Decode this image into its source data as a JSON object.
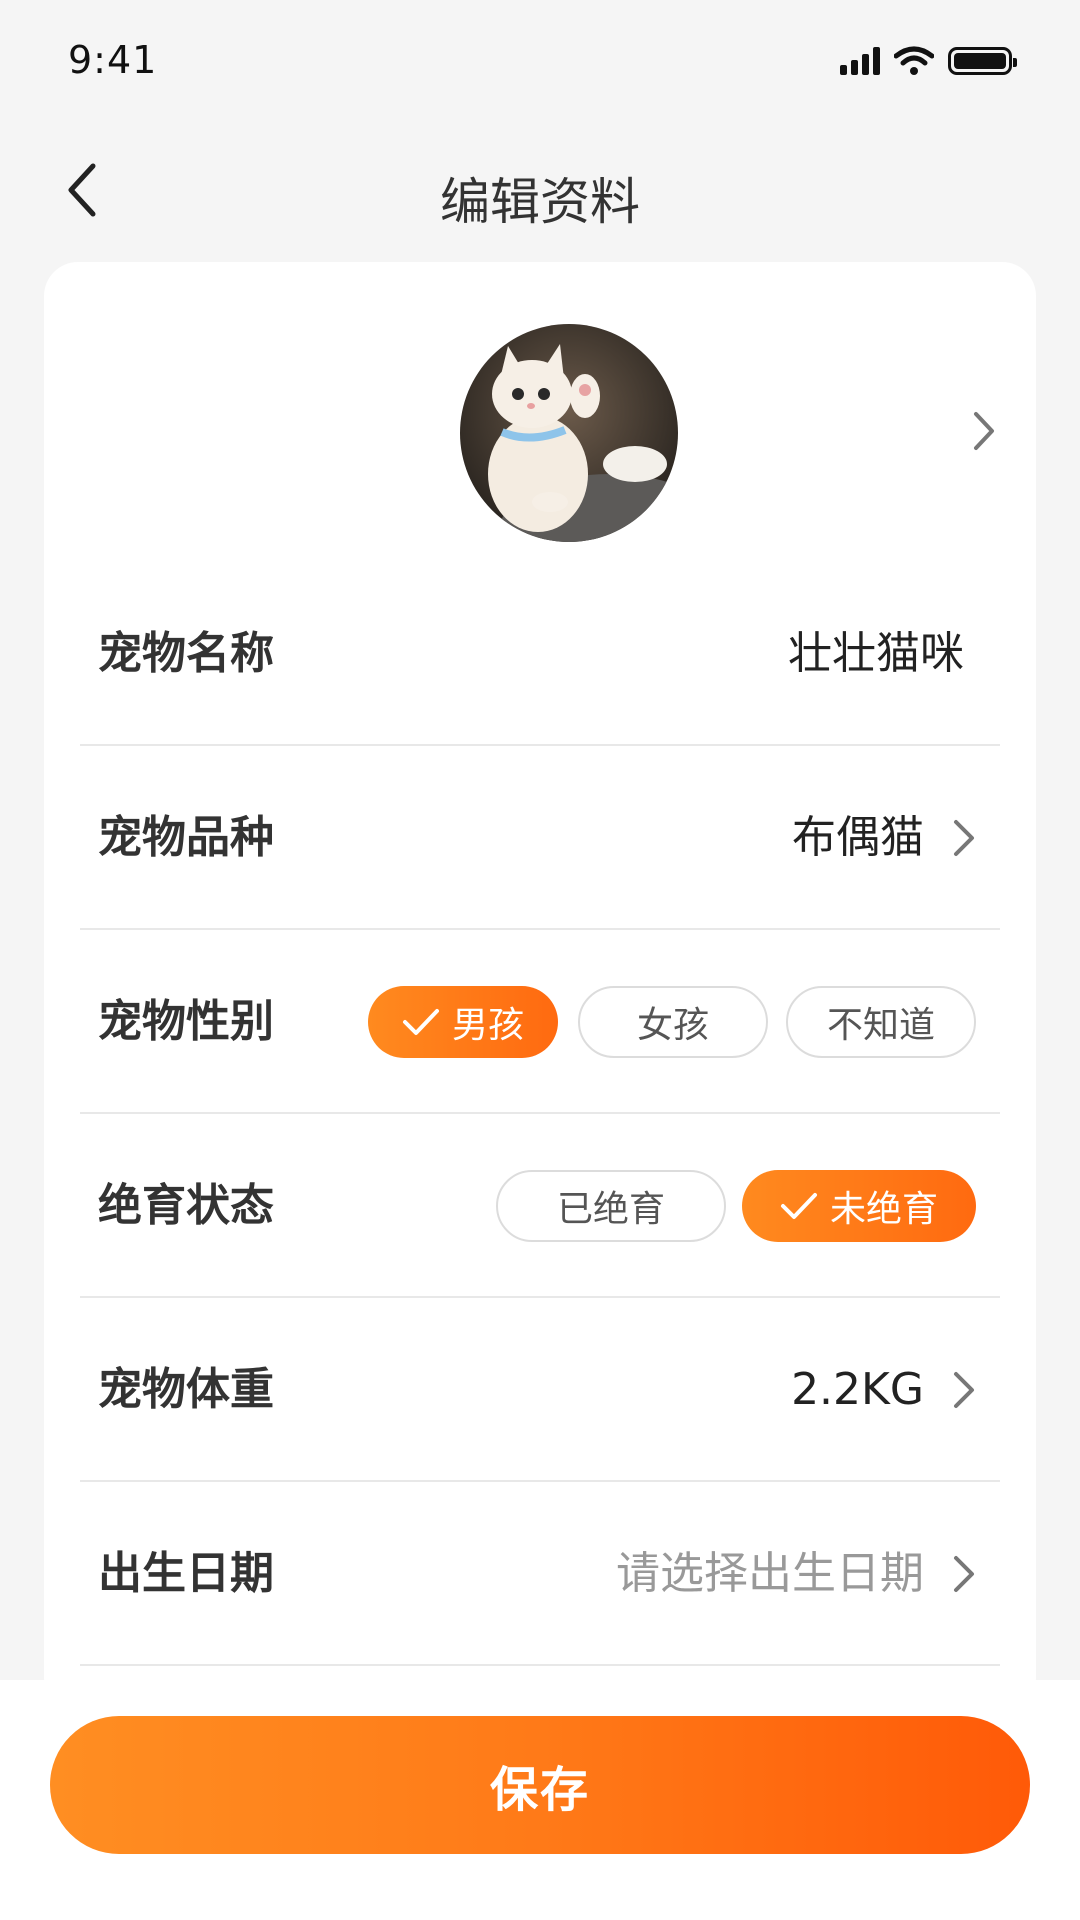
{
  "status_bar": {
    "time": "9:41"
  },
  "header": {
    "title": "编辑资料"
  },
  "profile": {
    "avatar": "cat-photo",
    "fields": {
      "name": {
        "label": "宠物名称",
        "value": "壮壮猫咪"
      },
      "breed": {
        "label": "宠物品种",
        "value": "布偶猫"
      },
      "gender": {
        "label": "宠物性别",
        "options": [
          "男孩",
          "女孩",
          "不知道"
        ],
        "selected": "男孩"
      },
      "neutered": {
        "label": "绝育状态",
        "options": [
          "已绝育",
          "未绝育"
        ],
        "selected": "未绝育"
      },
      "weight": {
        "label": "宠物体重",
        "value": "2.2KG"
      },
      "birthday": {
        "label": "出生日期",
        "placeholder": "请选择出生日期"
      }
    }
  },
  "actions": {
    "save_label": "保存"
  },
  "colors": {
    "accent": "#ff7a18",
    "accent_start": "#ff8e22",
    "accent_end": "#ff5a08",
    "background": "#f5f5f5",
    "card": "#ffffff"
  }
}
